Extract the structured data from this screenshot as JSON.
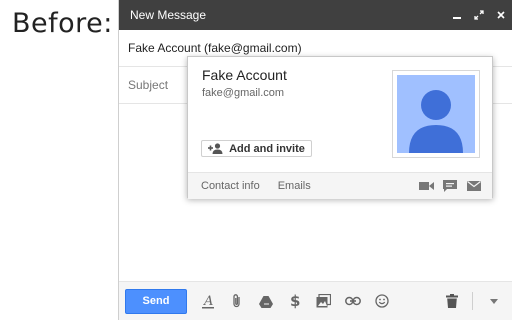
{
  "caption": "Before:",
  "compose": {
    "title": "New Message",
    "to_value": "Fake Account (fake@gmail.com)",
    "subject_placeholder": "Subject",
    "send_label": "Send"
  },
  "hovercard": {
    "name": "Fake Account",
    "email": "fake@gmail.com",
    "add_label": "Add and invite",
    "contact_info_label": "Contact info",
    "emails_label": "Emails"
  },
  "colors": {
    "titlebar": "#404040",
    "send_button": "#4d90fe",
    "avatar_bg": "#a0c0ff",
    "avatar_fg": "#3f6fd8"
  },
  "icons": [
    "minimize-icon",
    "popout-icon",
    "close-icon",
    "format-text-icon",
    "attach-icon",
    "drive-icon",
    "money-icon",
    "photo-icon",
    "link-icon",
    "emoji-icon",
    "trash-icon",
    "more-options-icon",
    "add-person-icon",
    "video-icon",
    "chat-icon",
    "mail-icon"
  ]
}
